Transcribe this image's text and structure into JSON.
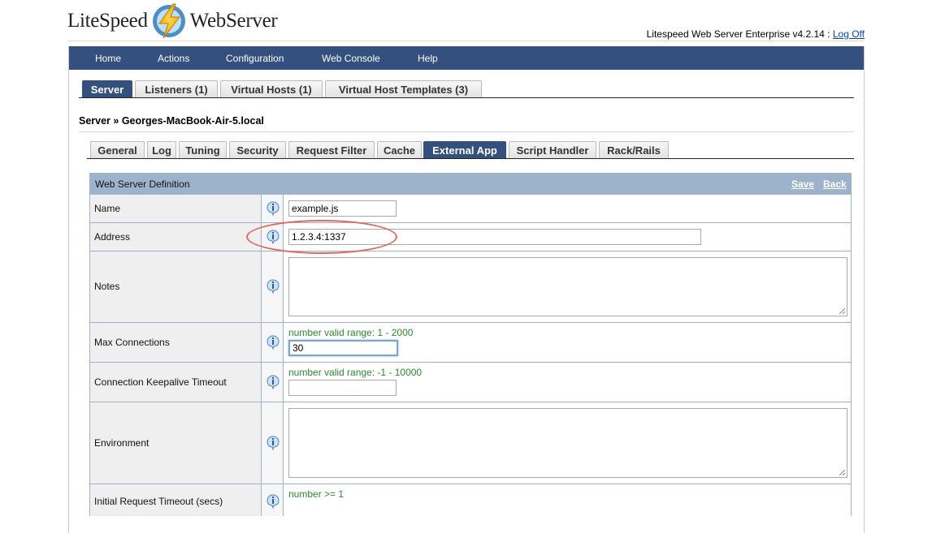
{
  "logo": {
    "left_text": "LiteSpeed",
    "right_text": "WebServer"
  },
  "header": {
    "version_text": "Litespeed Web Server Enterprise v4.2.14 :",
    "logoff_label": "Log Off"
  },
  "nav": {
    "items": [
      "Home",
      "Actions",
      "Configuration",
      "Web Console",
      "Help"
    ]
  },
  "main_tabs": [
    "Server",
    "Listeners (1)",
    "Virtual Hosts (1)",
    "Virtual Host Templates (3)"
  ],
  "breadcrumb": "Server » Georges-MacBook-Air-5.local",
  "sub_tabs": [
    "General",
    "Log",
    "Tuning",
    "Security",
    "Request Filter",
    "Cache",
    "External App",
    "Script Handler",
    "Rack/Rails"
  ],
  "active_sub_tab": "External App",
  "form": {
    "title": "Web Server Definition",
    "save_label": "Save",
    "back_label": "Back",
    "rows": {
      "name": {
        "label": "Name",
        "value": "example.js"
      },
      "address": {
        "label": "Address",
        "value": "1.2.3.4:1337"
      },
      "notes": {
        "label": "Notes",
        "value": ""
      },
      "max_connections": {
        "label": "Max Connections",
        "hint": "number valid range: 1 - 2000",
        "value": "30"
      },
      "keepalive": {
        "label": "Connection Keepalive Timeout",
        "hint": "number valid range: -1 - 10000",
        "value": ""
      },
      "environment": {
        "label": "Environment",
        "value": ""
      },
      "initial_timeout": {
        "label": "Initial Request Timeout (secs)",
        "hint": "number >= 1"
      }
    }
  },
  "colors": {
    "nav_bg": "#33507f",
    "table_head": "#9db3cc",
    "hint": "#2b8a2b",
    "annotation": "#e06a5e"
  }
}
